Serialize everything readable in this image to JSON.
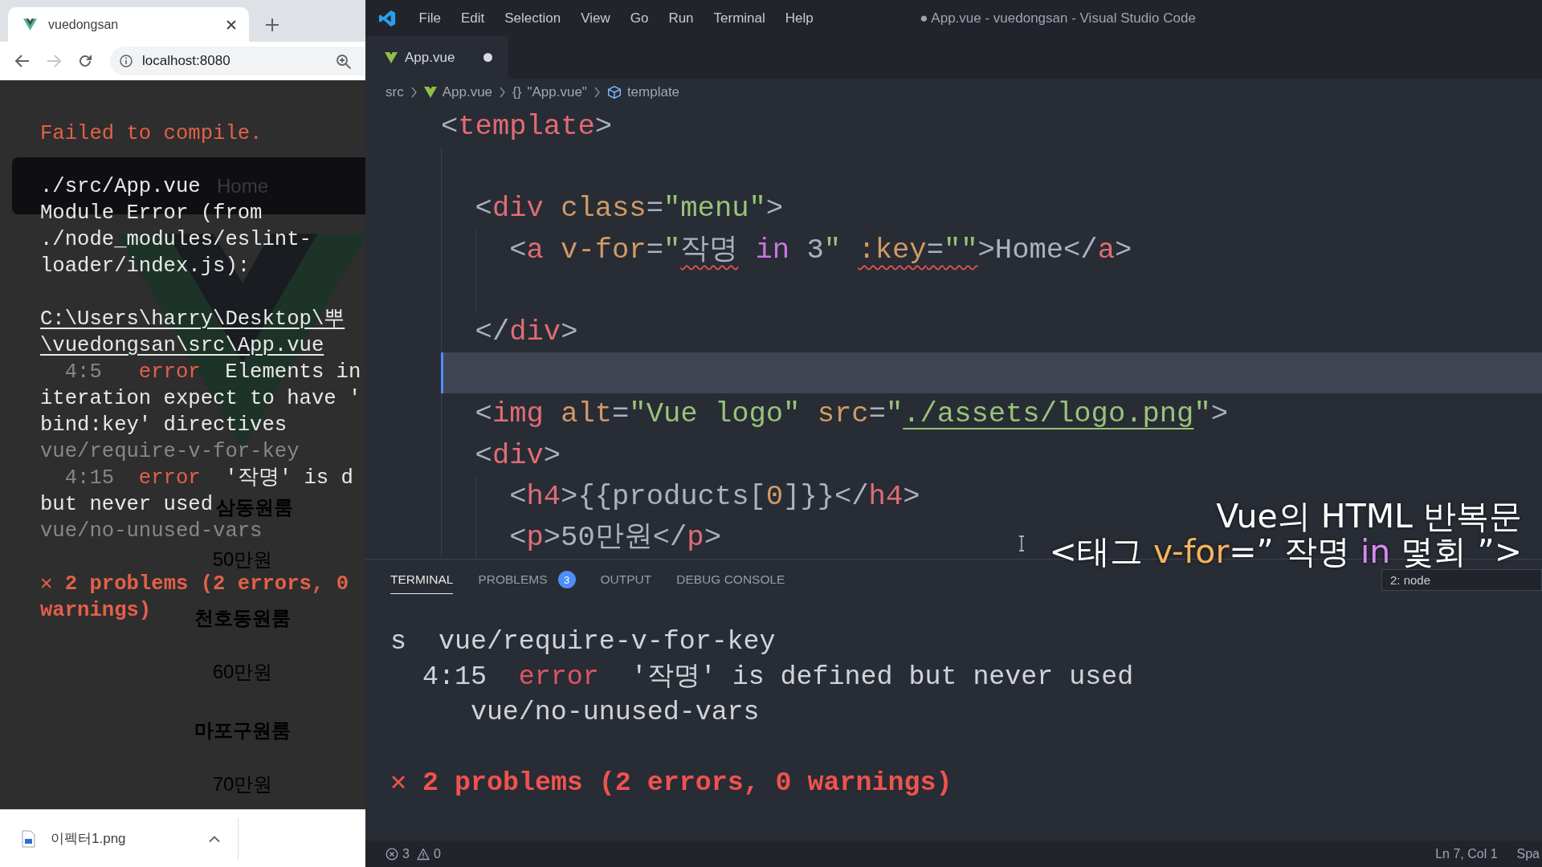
{
  "browser": {
    "tabs": [
      {
        "title": "vuedongsan",
        "selected": true
      }
    ],
    "nav_buttons": [
      {
        "kind": "back",
        "disabled": false
      },
      {
        "kind": "forward",
        "disabled": true
      },
      {
        "kind": "reload",
        "disabled": false
      }
    ],
    "address": "localhost:8080",
    "page": {
      "menu_link": "Home",
      "products": [
        {
          "name": "삼동원룸",
          "price": "50만원"
        },
        {
          "name": "천호동원룸",
          "price": "60만원"
        },
        {
          "name": "마포구원룸",
          "price": "70만원"
        }
      ]
    },
    "error_overlay": {
      "title": "Failed to compile.",
      "lines": [
        {
          "kind": "message",
          "tokens": [
            {
              "text": "./src/App.vue",
              "kind": "plain"
            }
          ]
        },
        {
          "kind": "message",
          "tokens": [
            {
              "text": "Module Error (from",
              "kind": "plain"
            }
          ]
        },
        {
          "kind": "message",
          "tokens": [
            {
              "text": "./node_modules/eslint-",
              "kind": "plain"
            }
          ]
        },
        {
          "kind": "message",
          "tokens": [
            {
              "text": "loader/index.js):",
              "kind": "plain"
            }
          ]
        },
        {
          "kind": "path",
          "tokens": [
            {
              "text": "C:\\Users\\harry\\Desktop\\뿌",
              "kind": "plain"
            }
          ]
        },
        {
          "kind": "path",
          "tokens": [
            {
              "text": "\\vuedongsan\\src\\App.vue",
              "kind": "plain"
            }
          ]
        },
        {
          "kind": "message",
          "tokens": [
            {
              "text": "  4:5",
              "kind": "muted"
            },
            {
              "text": "   error",
              "kind": "error"
            },
            {
              "text": "  Elements in",
              "kind": "plain"
            }
          ]
        },
        {
          "kind": "message",
          "tokens": [
            {
              "text": "iteration expect to have '",
              "kind": "plain"
            }
          ]
        },
        {
          "kind": "message",
          "tokens": [
            {
              "text": "bind:key' directives",
              "kind": "plain"
            }
          ]
        },
        {
          "kind": "message",
          "tokens": [
            {
              "text": "vue/require-v-for-key",
              "kind": "muted"
            }
          ]
        },
        {
          "kind": "message",
          "tokens": [
            {
              "text": "  4:15",
              "kind": "muted"
            },
            {
              "text": "  error",
              "kind": "error"
            },
            {
              "text": "  '작명' is d",
              "kind": "plain"
            }
          ]
        },
        {
          "kind": "message",
          "tokens": [
            {
              "text": "but never used",
              "kind": "plain"
            }
          ]
        },
        {
          "kind": "message",
          "tokens": [
            {
              "text": "vue/no-unused-vars",
              "kind": "muted"
            }
          ]
        },
        {
          "kind": "summary",
          "tokens": [
            {
              "text": "✕ 2 problems (2 errors, 0",
              "kind": "error"
            }
          ]
        },
        {
          "kind": "summary",
          "tokens": [
            {
              "text": "warnings)",
              "kind": "error"
            }
          ]
        }
      ]
    },
    "download": {
      "file": "이펙터1.png"
    }
  },
  "vscode": {
    "menu": [
      "File",
      "Edit",
      "Selection",
      "View",
      "Go",
      "Run",
      "Terminal",
      "Help"
    ],
    "title": "● App.vue - vuedongsan - Visual Studio Code",
    "tabs": [
      {
        "label": "App.vue",
        "selected": true,
        "dirty": true
      }
    ],
    "breadcrumbs": [
      {
        "text": "src",
        "kind": "folder"
      },
      {
        "text": "App.vue",
        "kind": "vue-file"
      },
      {
        "text": "\"App.vue\"",
        "kind": "object",
        "symbol": "{}"
      },
      {
        "text": "template",
        "kind": "element"
      }
    ],
    "editor": {
      "lines": [
        {
          "current": false,
          "tokens": [
            {
              "text": "<",
              "kind": "text"
            },
            {
              "text": "template",
              "kind": "tag"
            },
            {
              "text": ">",
              "kind": "text"
            }
          ]
        },
        {
          "current": false
        },
        {
          "current": false,
          "tokens": [
            {
              "text": "  <",
              "kind": "text"
            },
            {
              "text": "div",
              "kind": "tag"
            },
            {
              "text": " class",
              "kind": "attr"
            },
            {
              "text": "=",
              "kind": "text"
            },
            {
              "text": "\"menu\"",
              "kind": "string"
            },
            {
              "text": ">",
              "kind": "text"
            }
          ]
        },
        {
          "current": false,
          "tokens": [
            {
              "text": "    <",
              "kind": "text"
            },
            {
              "text": "a",
              "kind": "tag"
            },
            {
              "text": " v-for",
              "kind": "attr"
            },
            {
              "text": "=",
              "kind": "text"
            },
            {
              "text": "\"",
              "kind": "string"
            },
            {
              "text": "작명",
              "kind": "text",
              "error": true
            },
            {
              "text": " in",
              "kind": "keyword"
            },
            {
              "text": " 3",
              "kind": "text"
            },
            {
              "text": "\" ",
              "kind": "string"
            },
            {
              "text": ":key",
              "kind": "attr",
              "error": true
            },
            {
              "text": "=",
              "kind": "text",
              "error": true
            },
            {
              "text": "\"\"",
              "kind": "string",
              "error": true
            },
            {
              "text": ">Home</",
              "kind": "text"
            },
            {
              "text": "a",
              "kind": "tag"
            },
            {
              "text": ">",
              "kind": "text"
            }
          ]
        },
        {
          "current": false
        },
        {
          "current": false,
          "tokens": [
            {
              "text": "  </",
              "kind": "text"
            },
            {
              "text": "div",
              "kind": "tag"
            },
            {
              "text": ">",
              "kind": "text"
            }
          ]
        },
        {
          "current": true
        },
        {
          "current": false,
          "tokens": [
            {
              "text": "  <",
              "kind": "text"
            },
            {
              "text": "img",
              "kind": "tag"
            },
            {
              "text": " alt",
              "kind": "attr"
            },
            {
              "text": "=",
              "kind": "text"
            },
            {
              "text": "\"Vue logo\"",
              "kind": "string"
            },
            {
              "text": " src",
              "kind": "attr"
            },
            {
              "text": "=",
              "kind": "text"
            },
            {
              "text": "\"",
              "kind": "string"
            },
            {
              "text": "./assets/logo.png",
              "kind": "string",
              "link": true
            },
            {
              "text": "\"",
              "kind": "string"
            },
            {
              "text": ">",
              "kind": "text"
            }
          ]
        },
        {
          "current": false,
          "tokens": [
            {
              "text": "  <",
              "kind": "text"
            },
            {
              "text": "div",
              "kind": "tag"
            },
            {
              "text": ">",
              "kind": "text"
            }
          ]
        },
        {
          "current": false,
          "tokens": [
            {
              "text": "    <",
              "kind": "text"
            },
            {
              "text": "h4",
              "kind": "tag"
            },
            {
              "text": ">{{products[",
              "kind": "text"
            },
            {
              "text": "0",
              "kind": "number"
            },
            {
              "text": "]}}</",
              "kind": "text"
            },
            {
              "text": "h4",
              "kind": "tag"
            },
            {
              "text": ">",
              "kind": "text"
            }
          ]
        },
        {
          "current": false,
          "tokens": [
            {
              "text": "    <",
              "kind": "text"
            },
            {
              "text": "p",
              "kind": "tag"
            },
            {
              "text": ">50만원</",
              "kind": "text"
            },
            {
              "text": "p",
              "kind": "tag"
            },
            {
              "text": ">",
              "kind": "text"
            }
          ]
        }
      ]
    },
    "panel": {
      "tabs": [
        {
          "label": "TERMINAL",
          "selected": true
        },
        {
          "label": "PROBLEMS",
          "selected": false,
          "badge": "3"
        },
        {
          "label": "OUTPUT",
          "selected": false
        },
        {
          "label": "DEBUG CONSOLE",
          "selected": false
        }
      ],
      "terminal_select": {
        "value": "2: node"
      },
      "lines": [
        {
          "kind": "output",
          "tokens": [
            {
              "text": "s  vue/require-v-for-key",
              "kind": "plain"
            }
          ]
        },
        {
          "kind": "output",
          "tokens": [
            {
              "text": "  4:15",
              "kind": "plain"
            },
            {
              "text": "  error",
              "kind": "error"
            },
            {
              "text": "  '작명' is defined but never used",
              "kind": "plain"
            }
          ]
        },
        {
          "kind": "output",
          "tokens": [
            {
              "text": "     vue/no-unused-vars",
              "kind": "plain"
            }
          ]
        },
        {
          "kind": "summary",
          "tokens": [
            {
              "text": "✕ 2 problems (2 errors, 0 warnings)",
              "kind": "error"
            }
          ]
        }
      ]
    },
    "status_bar": {
      "errors": "3",
      "warnings": "0",
      "position": "Ln 7, Col 1",
      "indentation": "Spa"
    }
  },
  "caption": {
    "lines": [
      {
        "tokens": [
          {
            "text": "Vue의 HTML 반복문",
            "kind": "plain"
          }
        ]
      },
      {
        "tokens": [
          {
            "text": "<태그 ",
            "kind": "plain"
          },
          {
            "text": "v-for",
            "kind": "directive"
          },
          {
            "text": "=” 작명 ",
            "kind": "plain"
          },
          {
            "text": "in",
            "kind": "keyword"
          },
          {
            "text": " 몇회 ”>",
            "kind": "plain"
          }
        ]
      }
    ]
  }
}
